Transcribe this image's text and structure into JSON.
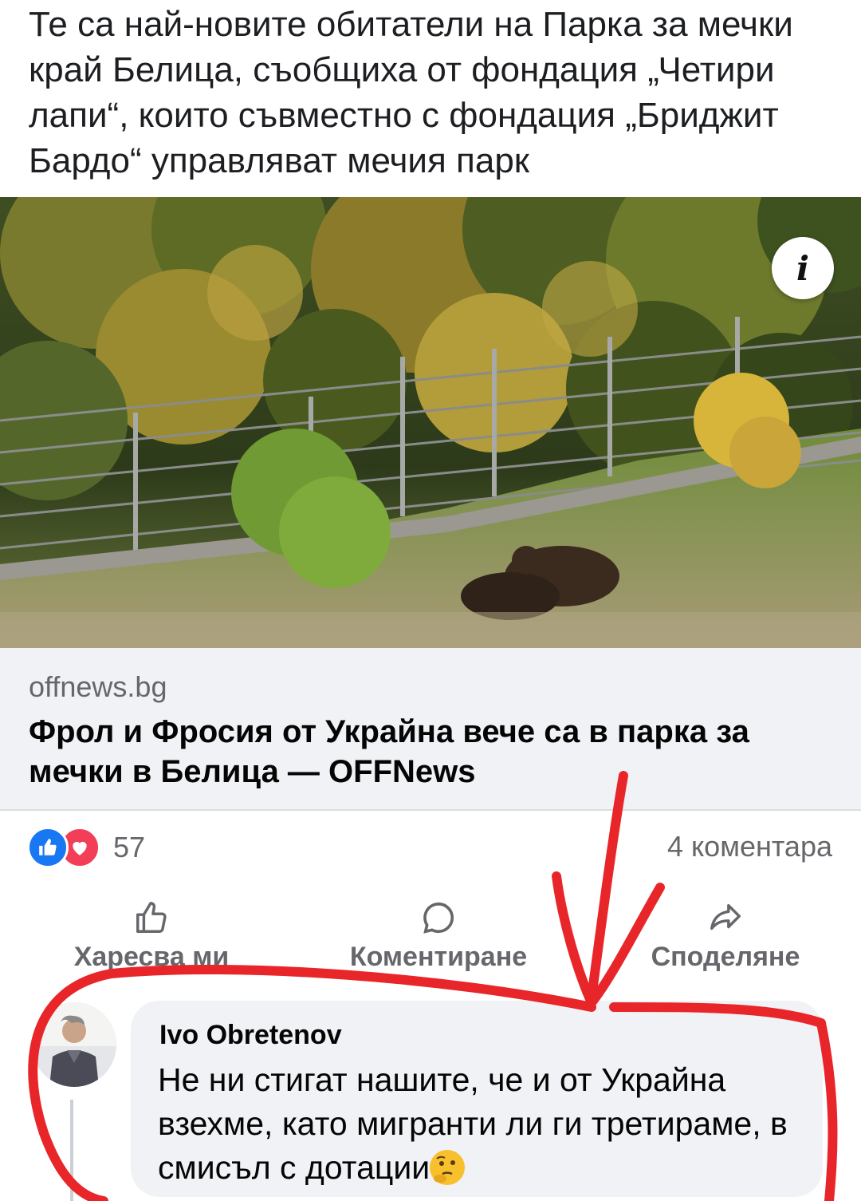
{
  "post": {
    "text": "Те са най-новите обитатели на Парка за мечки край Белица, съобщиха от фондация „Четири лапи“, които съвместно с фондация „Бриджит Бардо“ управляват мечия парк"
  },
  "link": {
    "domain": "offnews.bg",
    "title": "Фрол и Фросия от Украйна вече са в парка за мечки в Белица — OFFNews"
  },
  "reactions": {
    "count": "57",
    "comments": "4 коментара"
  },
  "actions": {
    "like": "Харесва ми",
    "comment": "Коментиране",
    "share": "Споделяне"
  },
  "comment": {
    "author": "Ivo Obretenov",
    "text": "Не ни стигат нашите,  че и от Украйна взехме, като мигранти  ли ги третираме, в смисъл с дотации"
  },
  "icons": {
    "info": "info-icon",
    "like": "thumbs-up-icon",
    "love": "heart-icon",
    "comment": "comment-bubble-icon",
    "share": "share-arrow-icon",
    "emoji": "thinking-face-emoji"
  },
  "colors": {
    "accent": "#1877f2",
    "love": "#f33e58",
    "annotation": "#e8262a",
    "secondary_text": "#65676b"
  }
}
